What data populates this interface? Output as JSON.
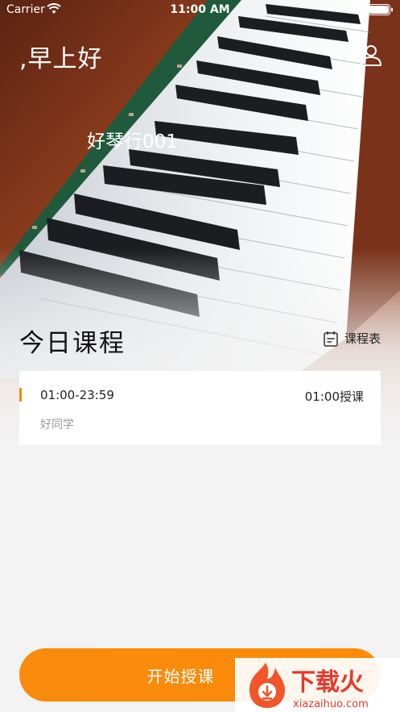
{
  "status_bar": {
    "carrier": "Carrier",
    "time": "11:00 AM"
  },
  "header": {
    "greeting": ",早上好",
    "school_name": "好琴行001",
    "user_icon": "user-icon"
  },
  "today": {
    "title": "今日课程",
    "schedule_label": "课程表",
    "schedule_icon": "calendar-icon"
  },
  "course": {
    "time": "01:00-23:59",
    "status": "01:00授课",
    "student": "好同学",
    "accent_color": "#f38c12"
  },
  "start_button": {
    "label": "开始授课",
    "color": "#f98b0c"
  },
  "watermark": {
    "brand": "下载火",
    "url": "xiazaihuo.com"
  }
}
